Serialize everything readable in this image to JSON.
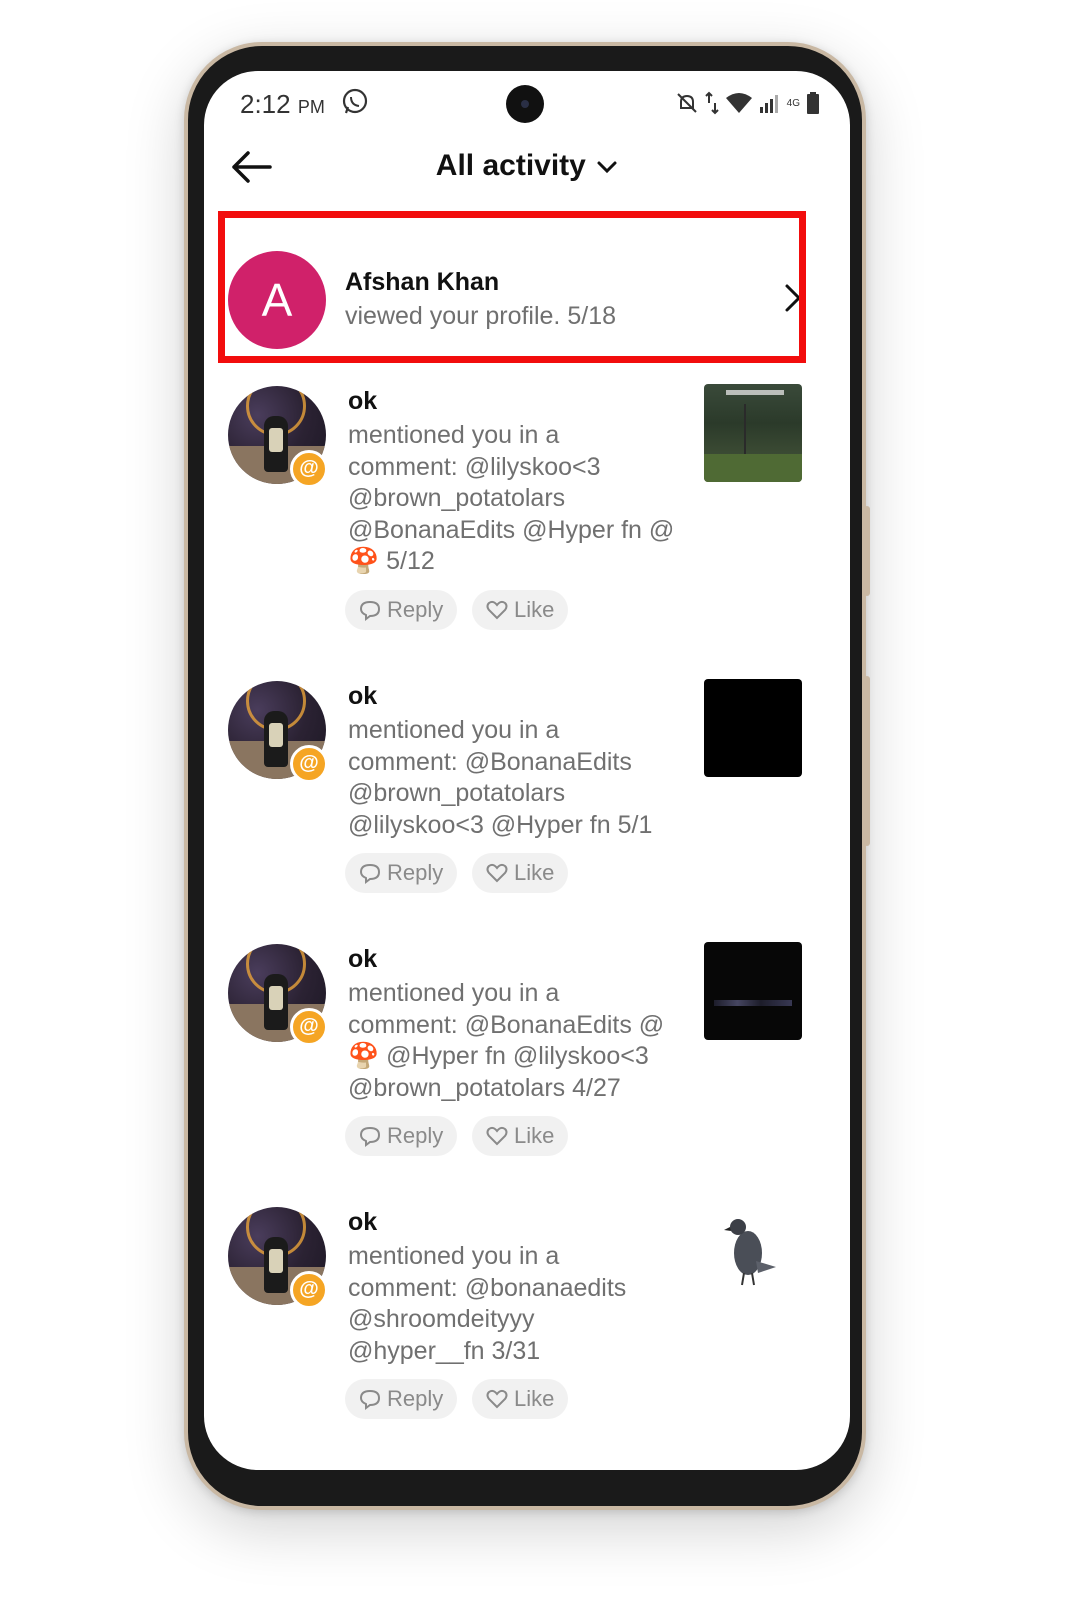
{
  "status_bar": {
    "time": "2:12",
    "ampm": "PM",
    "network": "4G"
  },
  "header": {
    "title": "All activity"
  },
  "profile_view": {
    "initial": "A",
    "name": "Afshan Khan",
    "text": "viewed your profile.",
    "date": "5/18"
  },
  "mentions": [
    {
      "username": "ok",
      "line1": "mentioned you in a",
      "line2": "comment: @lilyskoo<3",
      "line3": "@brown_potatolars",
      "line4": "@BonanaEdits @Hyper fn @",
      "line5_emoji": "🍄",
      "line5": "5/12",
      "reply": "Reply",
      "like": "Like"
    },
    {
      "username": "ok",
      "line1": "mentioned you in a",
      "line2": "comment: @BonanaEdits",
      "line3": "@brown_potatolars",
      "line4": "@lilyskoo<3 @Hyper fn 5/1",
      "reply": "Reply",
      "like": "Like"
    },
    {
      "username": "ok",
      "line1": "mentioned you in a",
      "line2": "comment: @BonanaEdits @",
      "line3_emoji": "🍄",
      "line3": "@Hyper fn @lilyskoo<3",
      "line4": "@brown_potatolars 4/27",
      "reply": "Reply",
      "like": "Like"
    },
    {
      "username": "ok",
      "line1": "mentioned you in a",
      "line2": "comment: @bonanaedits",
      "line3": "@shroomdeityyy",
      "line4": "@hyper__fn 3/31",
      "reply": "Reply",
      "like": "Like"
    }
  ],
  "icons": {
    "back": "arrow-left-icon",
    "dropdown": "chevron-down-icon",
    "chevron": "chevron-right-icon",
    "reply": "chat-bubble-icon",
    "like": "heart-icon",
    "mention": "at-sign-icon"
  },
  "colors": {
    "highlight": "#f20d0d",
    "avatar_bg": "#d0216a",
    "mention_badge": "#f5a524"
  }
}
